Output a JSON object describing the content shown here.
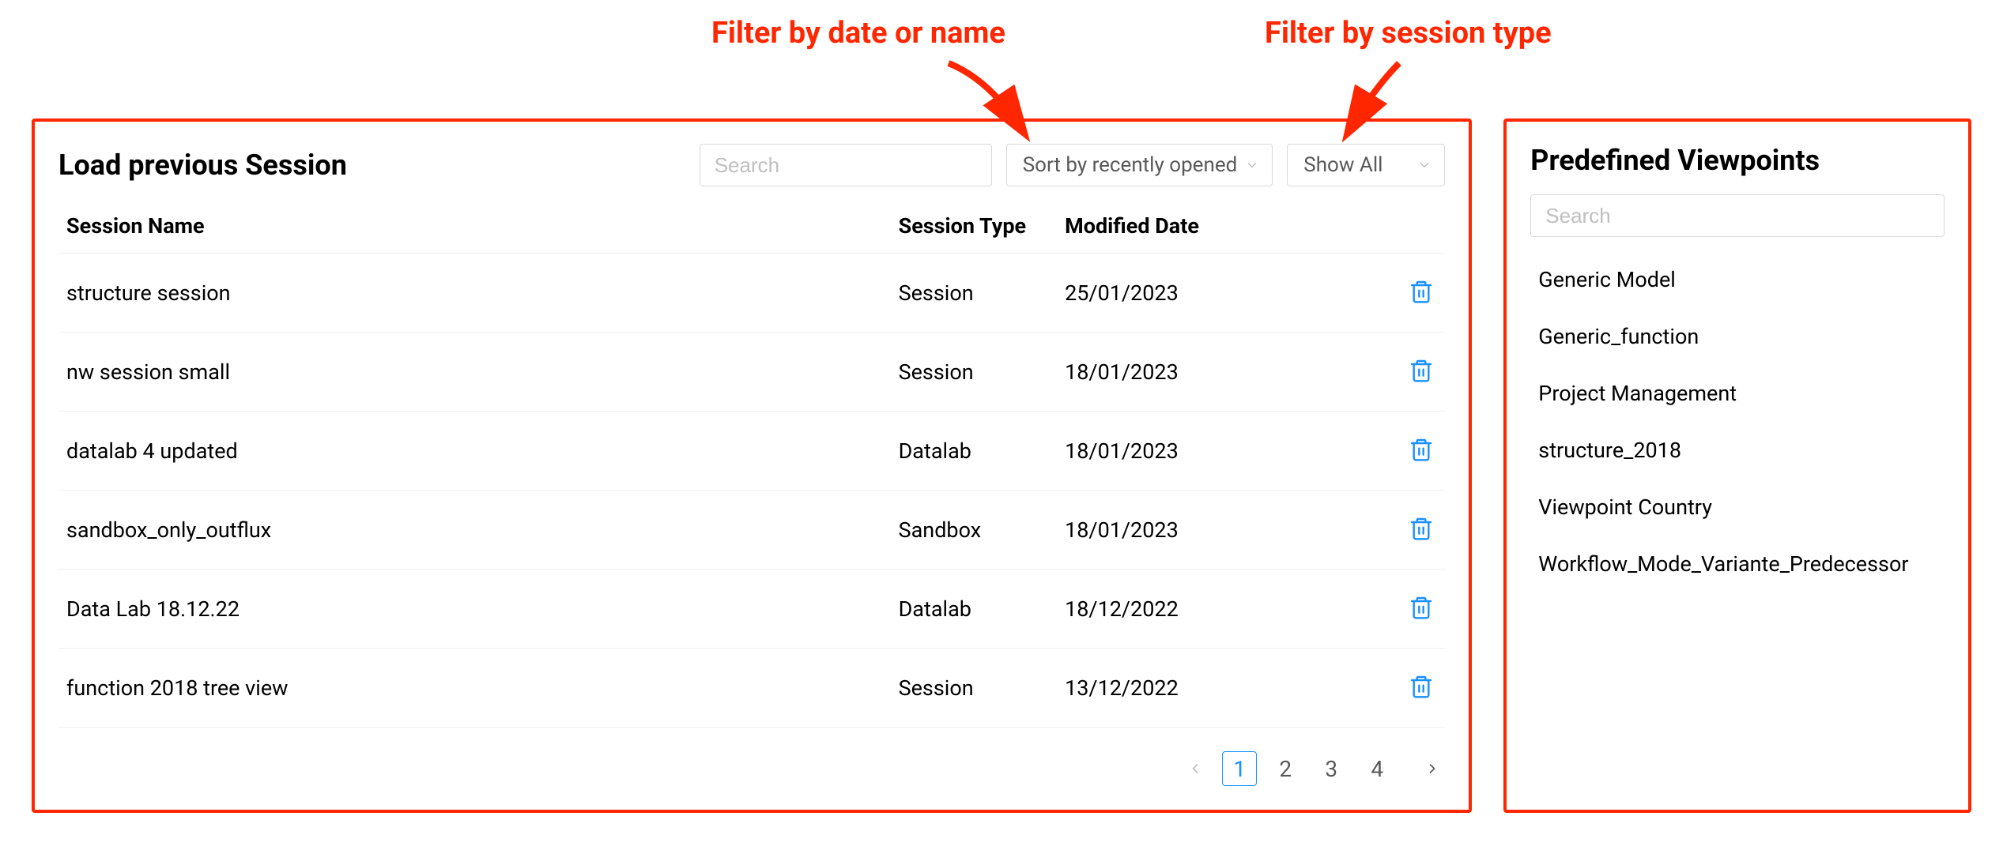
{
  "annotations": {
    "left": "Filter by date or name",
    "right": "Filter by session type"
  },
  "sessions": {
    "title": "Load previous Session",
    "search_placeholder": "Search",
    "sort_value": "Sort by recently opened",
    "type_filter_value": "Show All",
    "columns": {
      "name": "Session Name",
      "type": "Session Type",
      "date": "Modified Date"
    },
    "rows": [
      {
        "name": "structure session",
        "type": "Session",
        "date": "25/01/2023"
      },
      {
        "name": "nw session small",
        "type": "Session",
        "date": "18/01/2023"
      },
      {
        "name": "datalab 4 updated",
        "type": "Datalab",
        "date": "18/01/2023"
      },
      {
        "name": "sandbox_only_outflux",
        "type": "Sandbox",
        "date": "18/01/2023"
      },
      {
        "name": "Data Lab 18.12.22",
        "type": "Datalab",
        "date": "18/12/2022"
      },
      {
        "name": "function 2018 tree view",
        "type": "Session",
        "date": "13/12/2022"
      }
    ],
    "pagination": {
      "pages": [
        "1",
        "2",
        "3",
        "4"
      ],
      "active": "1"
    }
  },
  "viewpoints": {
    "title": "Predefined Viewpoints",
    "search_placeholder": "Search",
    "items": [
      "Generic Model",
      "Generic_function",
      "Project Management",
      "structure_2018",
      "Viewpoint Country",
      "Workflow_Mode_Variante_Predecessor"
    ]
  }
}
